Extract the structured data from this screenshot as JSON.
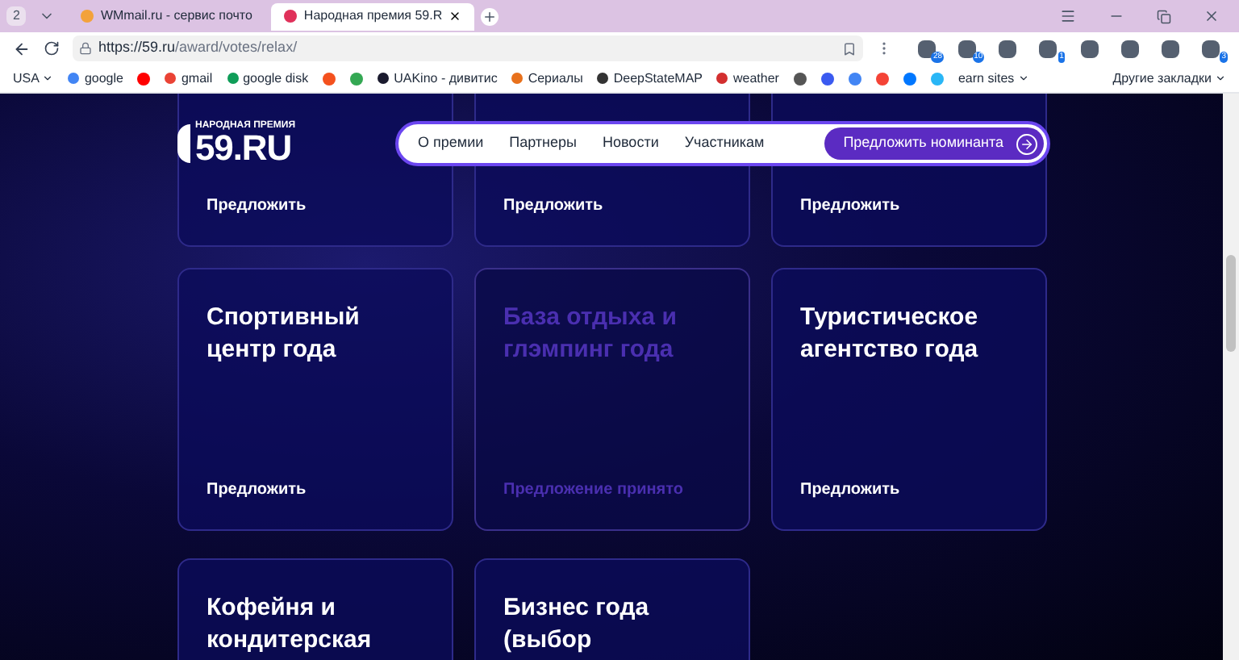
{
  "browser": {
    "tab_count": "2",
    "tabs": [
      {
        "title": "WMmail.ru - сервис почто",
        "selected": false
      },
      {
        "title": "Народная премия 59.R",
        "selected": true
      }
    ],
    "url": {
      "host": "https://59.ru",
      "path": "/award/votes/relax/"
    },
    "extensions": [
      {
        "kind": "badged",
        "badge": "28"
      },
      {
        "kind": "badged",
        "badge": "10"
      },
      {
        "kind": "plain"
      },
      {
        "kind": "badged",
        "badge": "1"
      },
      {
        "kind": "plain"
      },
      {
        "kind": "plain"
      },
      {
        "kind": "plain"
      },
      {
        "kind": "badged",
        "badge": "3"
      }
    ],
    "bookmarks": [
      {
        "kind": "folder",
        "label": "USA"
      },
      {
        "kind": "link",
        "label": "google",
        "color": "#4285f4"
      },
      {
        "kind": "icon",
        "color": "#ff0000"
      },
      {
        "kind": "link",
        "label": "gmail",
        "color": "#ea4335"
      },
      {
        "kind": "link",
        "label": "google disk",
        "color": "#0f9d58"
      },
      {
        "kind": "icon",
        "color": "#f4511e"
      },
      {
        "kind": "icon",
        "color": "#34a853"
      },
      {
        "kind": "link",
        "label": "UAKino - дивитис",
        "color": "#1a1a2e"
      },
      {
        "kind": "link",
        "label": "Сериалы",
        "color": "#e8711c"
      },
      {
        "kind": "link",
        "label": "DeepStateMAP",
        "color": "#333333"
      },
      {
        "kind": "link",
        "label": "weather",
        "color": "#d32f2f"
      },
      {
        "kind": "icon",
        "color": "#555555"
      },
      {
        "kind": "icon",
        "color": "#3a5af0"
      },
      {
        "kind": "icon",
        "color": "#4285f4"
      },
      {
        "kind": "icon",
        "color": "#f44336"
      },
      {
        "kind": "icon",
        "color": "#0077ff"
      },
      {
        "kind": "icon",
        "color": "#29b6f6"
      },
      {
        "kind": "folder",
        "label": "earn sites"
      }
    ],
    "other_bookmarks": "Другие закладки"
  },
  "site": {
    "logo": {
      "caption": "НАРОДНАЯ ПРЕМИЯ",
      "name": "59.RU"
    },
    "nav": [
      {
        "label": "О премии",
        "kind": "link"
      },
      {
        "label": "Партнеры",
        "kind": "link"
      },
      {
        "label": "Новости",
        "kind": "link"
      },
      {
        "label": "Участникам",
        "kind": "link"
      },
      {
        "label": "Предложить номинанта",
        "kind": "cta"
      }
    ],
    "cards": [
      {
        "action": "Предложить",
        "accepted": false
      },
      {
        "action": "Предложить",
        "accepted": false
      },
      {
        "action": "Предложить",
        "accepted": false
      },
      {
        "title": "Спортивный центр года",
        "action": "Предложить",
        "accepted": false
      },
      {
        "title": "База отдыха и глэмпинг года",
        "action": "Предложение принято",
        "accepted": true
      },
      {
        "title": "Туристическое агентство года",
        "action": "Предложить",
        "accepted": false
      },
      {
        "title": "Кофейня и кондитерская",
        "accepted": false
      },
      {
        "title": "Бизнес года (выбор",
        "accepted": false
      }
    ]
  }
}
